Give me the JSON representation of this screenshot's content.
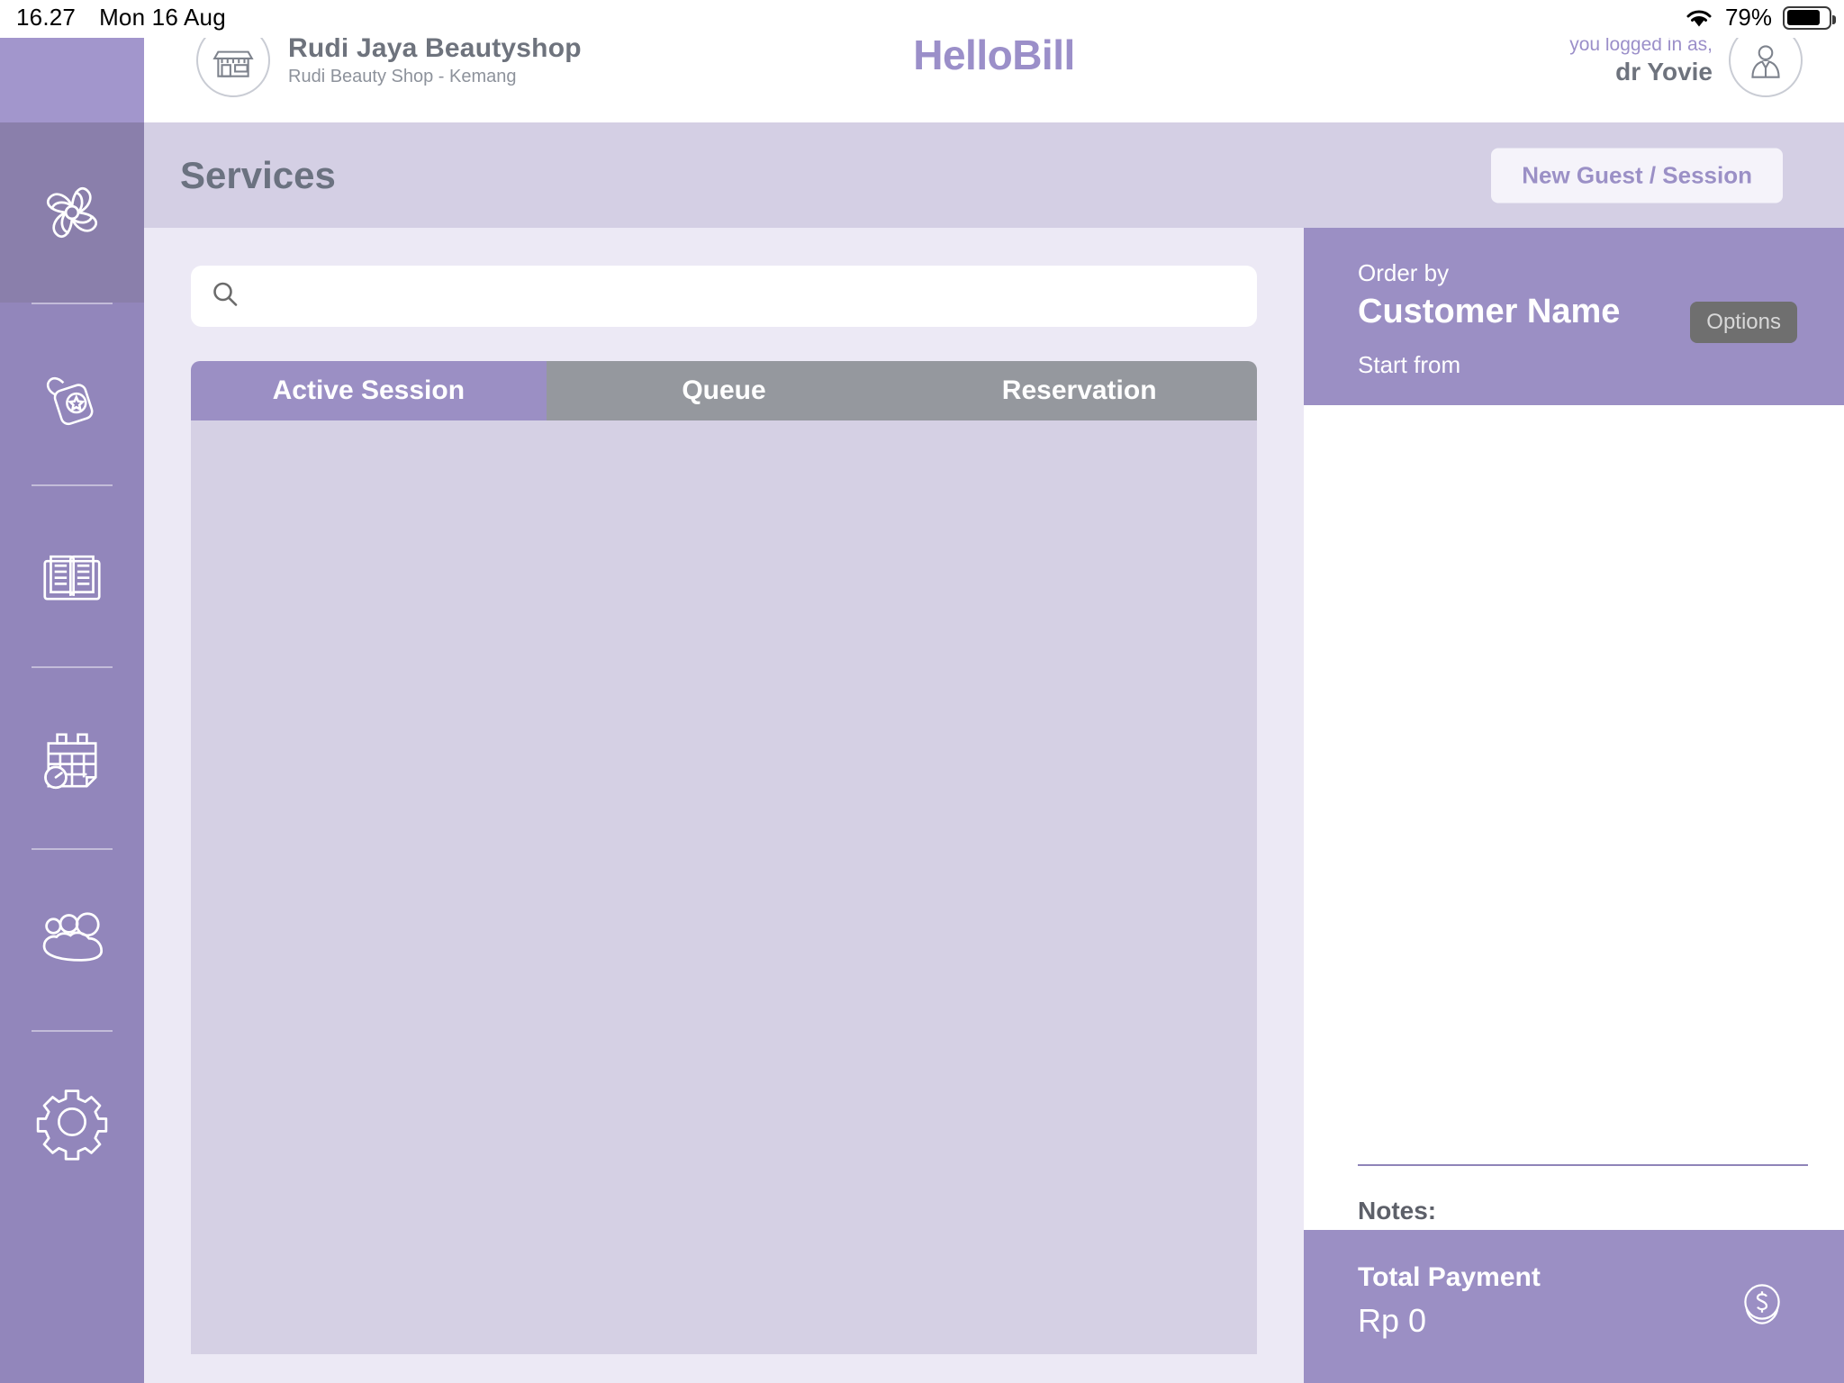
{
  "status_bar": {
    "time": "16.27",
    "date": "Mon 16 Aug",
    "battery_percent": "79%",
    "wifi_icon": "wifi-icon",
    "battery_icon": "battery-icon"
  },
  "header": {
    "shop_icon": "storefront-icon",
    "shop_name": "Rudi Jaya Beautyshop",
    "shop_branch": "Rudi Beauty Shop - Kemang",
    "brand": "HelloBill",
    "user_icon": "user-avatar-icon",
    "user_hint": "you logged in as,",
    "user_name": "dr Yovie"
  },
  "title_bar": {
    "title": "Services",
    "new_guest_button": "New Guest / Session"
  },
  "sidebar": {
    "items": [
      {
        "name": "sidebar-item-services",
        "icon": "flower-icon",
        "active": true
      },
      {
        "name": "sidebar-item-products",
        "icon": "door-hanger-tag-icon",
        "active": false
      },
      {
        "name": "sidebar-item-catalog",
        "icon": "open-book-icon",
        "active": false
      },
      {
        "name": "sidebar-item-schedule",
        "icon": "calendar-clock-icon",
        "active": false
      },
      {
        "name": "sidebar-item-customers",
        "icon": "people-group-icon",
        "active": false
      },
      {
        "name": "sidebar-item-settings",
        "icon": "gear-icon",
        "active": false
      }
    ]
  },
  "main": {
    "search": {
      "value": "",
      "placeholder": "",
      "icon": "search-icon"
    },
    "tabs": [
      {
        "label": "Active Session",
        "active": true
      },
      {
        "label": "Queue",
        "active": false
      },
      {
        "label": "Reservation",
        "active": false
      }
    ],
    "session_list_items": []
  },
  "right_panel": {
    "order_by_label": "Order by",
    "order_by_value": "Customer Name",
    "start_from_label": "Start from",
    "options_button": "Options",
    "notes_label": "Notes:",
    "total_label": "Total Payment",
    "total_value": "Rp 0",
    "total_icon": "dollar-coin-icon"
  },
  "colors": {
    "accent_purple": "#9b8fc4",
    "sidebar_purple": "#9286bb",
    "sidebar_active": "#8a7fab",
    "title_bar": "#d4cfe4",
    "content_bg": "#ece9f5",
    "list_bg": "#d5d0e4",
    "tab_inactive": "#95989e",
    "brand_purple": "#9b8fc9",
    "text_gray": "#6e737d"
  }
}
